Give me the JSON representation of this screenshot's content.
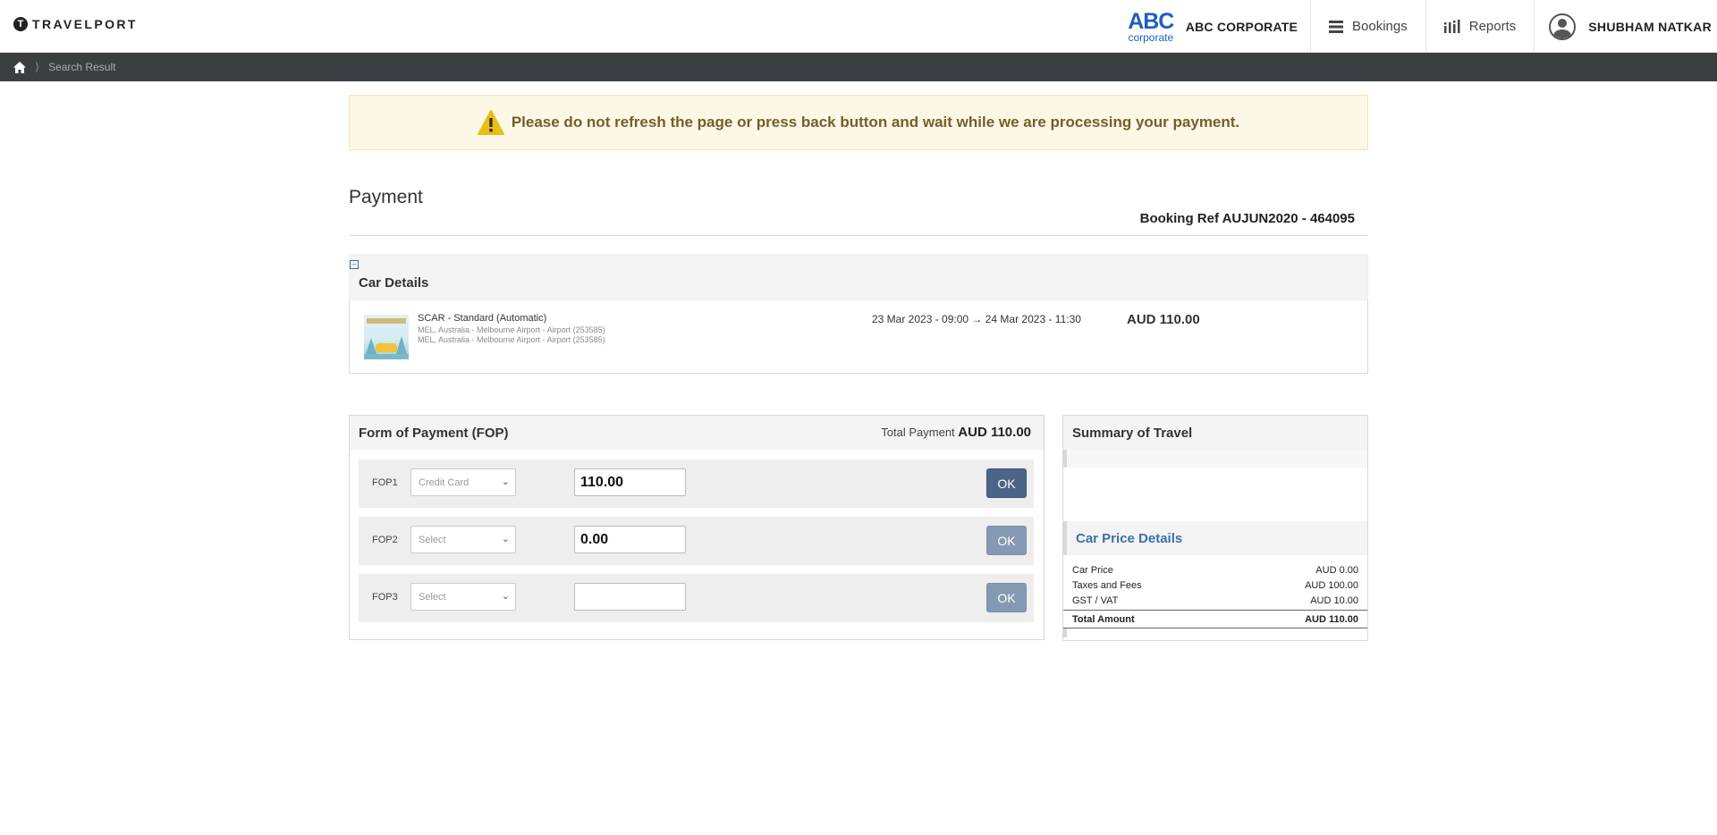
{
  "header": {
    "brand_mark": "T",
    "brand_name": "TRAVELPORT",
    "corp_logo_big": "ABC",
    "corp_logo_small": "corporate",
    "corp_name": "ABC CORPORATE",
    "nav": [
      {
        "label": "Bookings",
        "icon": "menu-icon"
      },
      {
        "label": "Reports",
        "icon": "bar-chart-icon"
      }
    ],
    "user_name": "SHUBHAM NATKAR"
  },
  "breadcrumb": {
    "home_icon": "home-icon",
    "current": "Search Result"
  },
  "alert": {
    "text": "Please do not refresh the page or press back button and wait while we are processing your payment.",
    "icon": "warning-icon"
  },
  "payment": {
    "title": "Payment",
    "booking_ref": "Booking Ref AUJUN2020 - 464095"
  },
  "car": {
    "section_title": "Car Details",
    "name": "SCAR - Standard (Automatic)",
    "pickup": "MEL, Australia - Melbourne Airport - Airport (253585)",
    "dropoff": "MEL, Australia - Melbourne Airport - Airport (253585)",
    "dates": "23 Mar 2023 - 09:00 → 24 Mar 2023 - 11:30",
    "price": "AUD 110.00"
  },
  "fop": {
    "title": "Form of Payment (FOP)",
    "total_label": "Total Payment",
    "total_value": "AUD 110.00",
    "rows": [
      {
        "label": "FOP1",
        "select": "Credit Card",
        "amount": "110.00",
        "ok": "OK",
        "ok_enabled": true
      },
      {
        "label": "FOP2",
        "select": "Select",
        "amount": "0.00",
        "ok": "OK",
        "ok_enabled": false
      },
      {
        "label": "FOP3",
        "select": "Select",
        "amount": "",
        "ok": "OK",
        "ok_enabled": false
      }
    ]
  },
  "summary": {
    "title": "Summary of Travel",
    "price_title": "Car Price Details",
    "rows": [
      {
        "label": "Car Price",
        "value": "AUD 0.00"
      },
      {
        "label": "Taxes and Fees",
        "value": "AUD 100.00"
      },
      {
        "label": "GST / VAT",
        "value": "AUD 10.00"
      }
    ],
    "total_label": "Total Amount",
    "total_value": "AUD 110.00"
  },
  "colors": {
    "accent": "#3e6fa8",
    "ok_button": "#4a6587",
    "ok_disabled": "#8699b2",
    "alert_bg": "#fcf8e5",
    "alert_text": "#735f2c",
    "crumb_bar": "#3b3f42"
  }
}
